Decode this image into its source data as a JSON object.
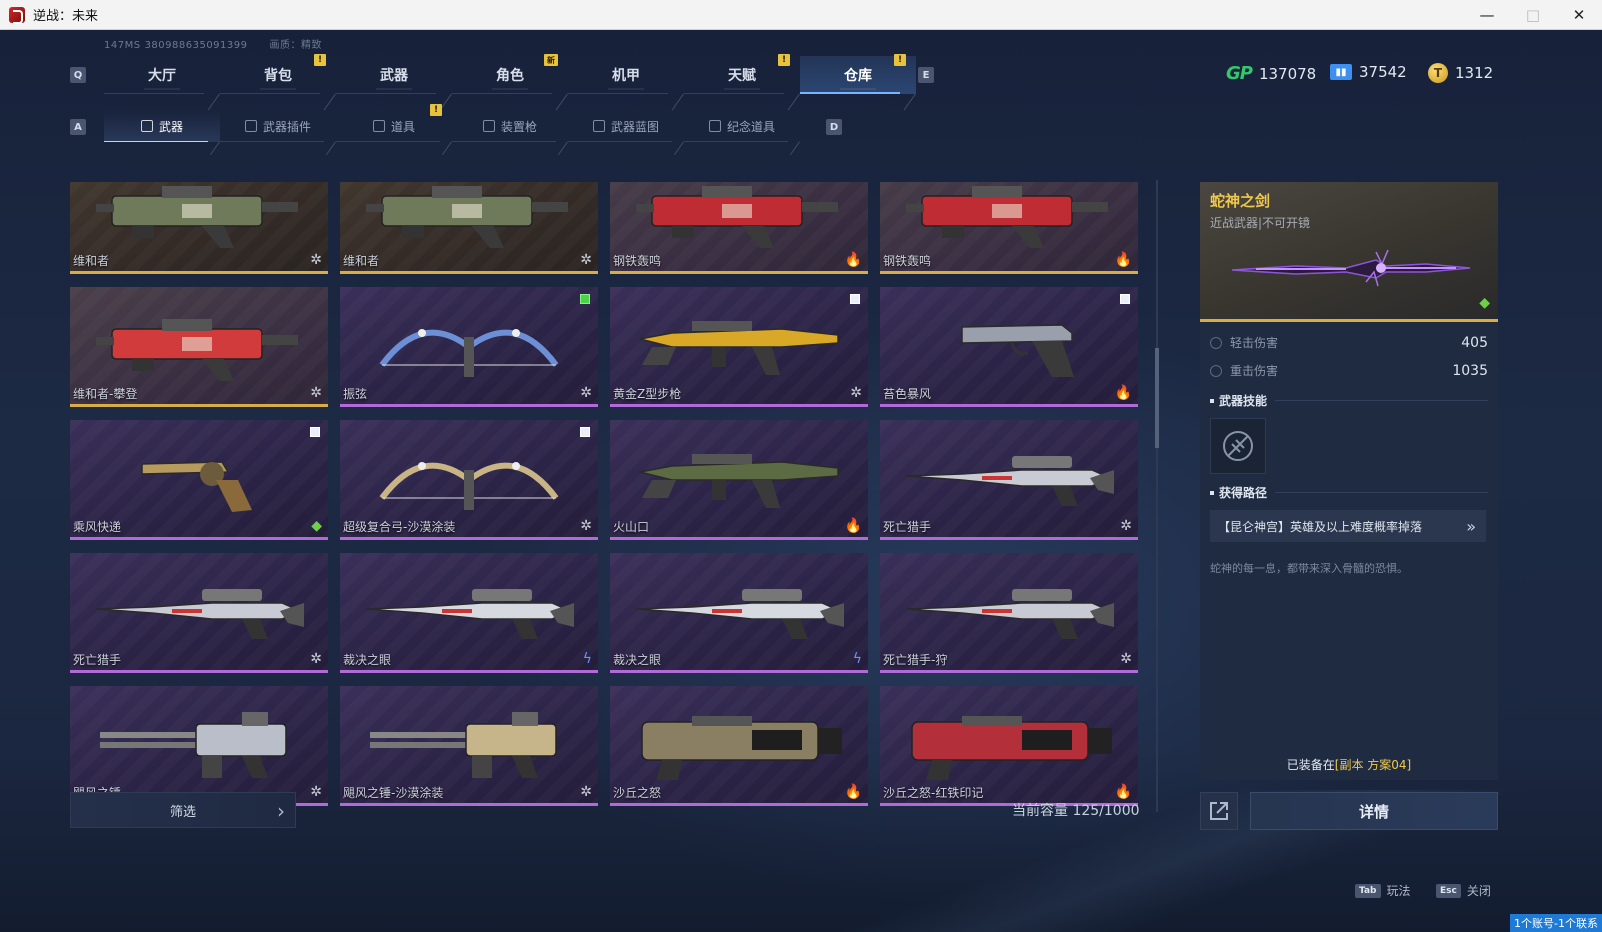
{
  "window": {
    "title": "逆战：未来"
  },
  "status": {
    "ping": "147MS",
    "id": "380988635091399",
    "quality": "画质：精致"
  },
  "main_tabs": [
    {
      "label": "大厅",
      "badge": "",
      "active": false
    },
    {
      "label": "背包",
      "badge": "!",
      "active": false
    },
    {
      "label": "武器",
      "badge": "",
      "active": false
    },
    {
      "label": "角色",
      "badge": "新",
      "active": false
    },
    {
      "label": "机甲",
      "badge": "",
      "active": false
    },
    {
      "label": "天赋",
      "badge": "!",
      "active": false
    },
    {
      "label": "仓库",
      "badge": "!",
      "active": true
    }
  ],
  "key_hints": {
    "prev_main": "Q",
    "next_main": "E",
    "prev_sub": "A",
    "next_sub": "D"
  },
  "currency": {
    "gp": "137078",
    "tickets": "37542",
    "coins": "1312",
    "gp_label": "GP"
  },
  "sub_tabs": [
    {
      "label": "武器",
      "active": true,
      "badge": ""
    },
    {
      "label": "武器插件",
      "active": false,
      "badge": ""
    },
    {
      "label": "道具",
      "active": false,
      "badge": "!"
    },
    {
      "label": "装置枪",
      "active": false,
      "badge": ""
    },
    {
      "label": "武器蓝图",
      "active": false,
      "badge": ""
    },
    {
      "label": "纪念道具",
      "active": false,
      "badge": ""
    }
  ],
  "items": [
    {
      "name": "维和者",
      "rarity": "gold",
      "tag": "star",
      "mark": "",
      "icon": "heavy-gun-icon",
      "color": "#6f7a5a"
    },
    {
      "name": "维和者",
      "rarity": "gold",
      "tag": "star",
      "mark": "",
      "icon": "heavy-gun-icon",
      "color": "#6f7a5a"
    },
    {
      "name": "钢铁轰鸣",
      "rarity": "legend",
      "tag": "fire",
      "mark": "",
      "icon": "heavy-gun-icon",
      "color": "#c02c34"
    },
    {
      "name": "钢铁轰鸣",
      "rarity": "legend",
      "tag": "fire",
      "mark": "",
      "icon": "heavy-gun-icon",
      "color": "#c02c34"
    },
    {
      "name": "维和者-攀登",
      "rarity": "legend",
      "tag": "star",
      "mark": "",
      "icon": "heavy-gun-icon",
      "color": "#d23b3b"
    },
    {
      "name": "振弦",
      "rarity": "epic",
      "tag": "star",
      "mark": "green",
      "icon": "bow-icon",
      "color": "#6c8fd6"
    },
    {
      "name": "黄金Z型步枪",
      "rarity": "epic",
      "tag": "star",
      "mark": "white",
      "icon": "rifle-icon",
      "color": "#d8a826"
    },
    {
      "name": "苔色暴风",
      "rarity": "epic",
      "tag": "fire",
      "mark": "white",
      "icon": "pistol-icon",
      "color": "#9aa0ab"
    },
    {
      "name": "乘风快递",
      "rarity": "epic",
      "tag": "gem",
      "mark": "white",
      "icon": "revolver-icon",
      "color": "#b79a5e"
    },
    {
      "name": "超级复合弓-沙漠涂装",
      "rarity": "epic",
      "tag": "star",
      "mark": "white",
      "icon": "bow-icon",
      "color": "#c9b486"
    },
    {
      "name": "火山口",
      "rarity": "epic",
      "tag": "fire",
      "mark": "",
      "icon": "rifle-icon",
      "color": "#5d6b45"
    },
    {
      "name": "死亡猎手",
      "rarity": "epic",
      "tag": "star",
      "mark": "",
      "icon": "sniper-icon",
      "color": "#c8cbd3"
    },
    {
      "name": "死亡猎手",
      "rarity": "epic",
      "tag": "star",
      "mark": "",
      "icon": "sniper-icon",
      "color": "#c8cbd3"
    },
    {
      "name": "裁决之眼",
      "rarity": "epic",
      "tag": "bolt",
      "mark": "",
      "icon": "sniper-icon",
      "color": "#d6d9e0"
    },
    {
      "name": "裁决之眼",
      "rarity": "epic",
      "tag": "bolt",
      "mark": "",
      "icon": "sniper-icon",
      "color": "#d6d9e0"
    },
    {
      "name": "死亡猎手-狩",
      "rarity": "epic",
      "tag": "star",
      "mark": "",
      "icon": "sniper-icon",
      "color": "#c8cbd3"
    },
    {
      "name": "飓风之锤",
      "rarity": "epic",
      "tag": "star",
      "mark": "",
      "icon": "minigun-icon",
      "color": "#b9bec8"
    },
    {
      "name": "飓风之锤-沙漠涂装",
      "rarity": "epic",
      "tag": "star",
      "mark": "",
      "icon": "minigun-icon",
      "color": "#c6b48a"
    },
    {
      "name": "沙丘之怒",
      "rarity": "epic",
      "tag": "fire",
      "mark": "",
      "icon": "cannon-icon",
      "color": "#8a7f62"
    },
    {
      "name": "沙丘之怒-红铁印记",
      "rarity": "epic",
      "tag": "fire",
      "mark": "",
      "icon": "cannon-icon",
      "color": "#b3303a"
    }
  ],
  "bottom": {
    "filter_label": "筛选",
    "capacity": "当前容量 125/1000"
  },
  "detail": {
    "name": "蛇神之剑",
    "subtitle": "近战武器|不可开镜",
    "stats": [
      {
        "label": "轻击伤害",
        "value": "405"
      },
      {
        "label": "重击伤害",
        "value": "1035"
      }
    ],
    "skill_heading": "武器技能",
    "source_heading": "获得路径",
    "source": "【昆仑神宫】英雄及以上难度概率掉落",
    "flavor": "蛇神的每一息，都带来深入骨髓的恐惧。",
    "equipped_prefix": "已装备在",
    "equipped_value": "[副本 方案04]",
    "detail_button": "详情"
  },
  "footer": {
    "tab_key": "Tab",
    "tab_label": "玩法",
    "esc_key": "Esc",
    "esc_label": "关闭",
    "account": "1个账号-1个联系"
  }
}
